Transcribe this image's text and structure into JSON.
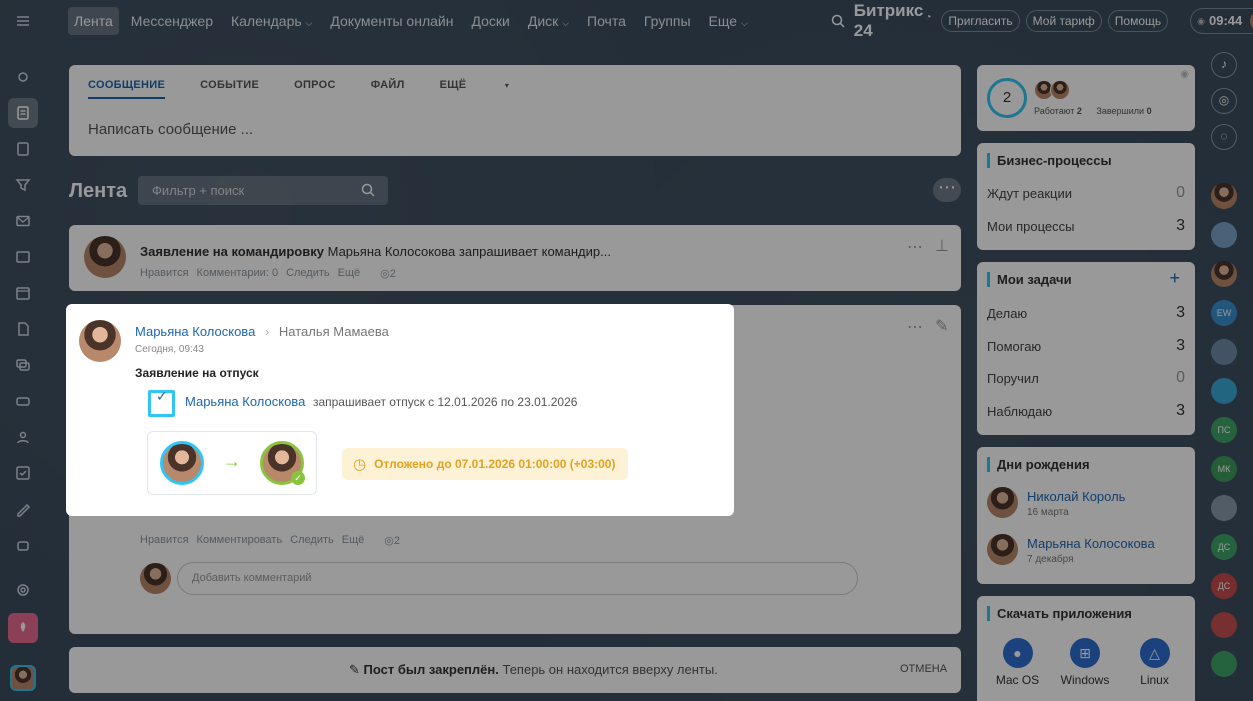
{
  "topbar": {
    "nav": [
      "Лента",
      "Мессенджер",
      "Календарь",
      "Документы онлайн",
      "Доски",
      "Диск",
      "Почта",
      "Группы",
      "Еще"
    ],
    "logo": "Битрикс 24",
    "invite": "Пригласить",
    "tariff": "Мой тариф",
    "help": "Помощь",
    "time": "09:44"
  },
  "composer": {
    "tabs": [
      "СООБЩЕНИЕ",
      "СОБЫТИЕ",
      "ОПРОС",
      "ФАЙЛ",
      "ЕЩЁ"
    ],
    "placeholder": "Написать сообщение ..."
  },
  "feed": {
    "title": "Лента",
    "filter_placeholder": "Фильтр + поиск"
  },
  "post1": {
    "title": "Заявление на командировку",
    "text": "Марьяна Колосокова запрашивает командир...",
    "actions": [
      "Нравится",
      "Комментарии: 0",
      "Следить",
      "Ещё"
    ],
    "views": "2"
  },
  "post2": {
    "actions": [
      "Нравится",
      "Комментировать",
      "Следить",
      "Ещё"
    ],
    "views": "2",
    "comment_placeholder": "Добавить комментарий"
  },
  "pinned": {
    "bold": "Пост был закреплён.",
    "text": "Теперь он находится вверху ленты.",
    "cancel": "ОТМЕНА"
  },
  "popup": {
    "author": "Марьяна Колоскова",
    "recipient": "Наталья Мамаева",
    "time": "Сегодня, 09:43",
    "title": "Заявление на отпуск",
    "requester": "Марьяна Колоскова",
    "request_text": "запрашивает отпуск с 12.01.2026 по 23.01.2026",
    "status": "Отложено до 07.01.2026 01:00:00 (+03:00)"
  },
  "stats": {
    "count": "2",
    "working_label": "Работают",
    "working": "2",
    "done_label": "Завершили",
    "done": "0"
  },
  "bp": {
    "title": "Бизнес-процессы",
    "rows": [
      {
        "label": "Ждут реакции",
        "value": "0"
      },
      {
        "label": "Мои процессы",
        "value": "3"
      }
    ]
  },
  "tasks": {
    "title": "Мои задачи",
    "rows": [
      {
        "label": "Делаю",
        "value": "3"
      },
      {
        "label": "Помогаю",
        "value": "3"
      },
      {
        "label": "Поручил",
        "value": "0"
      },
      {
        "label": "Наблюдаю",
        "value": "3"
      }
    ]
  },
  "birthdays": {
    "title": "Дни рождения",
    "people": [
      {
        "name": "Николай Король",
        "date": "16 марта"
      },
      {
        "name": "Марьяна Колосокова",
        "date": "7 декабря"
      }
    ]
  },
  "apps": {
    "title": "Скачать приложения",
    "items": [
      "Mac OS",
      "Windows",
      "Linux"
    ]
  },
  "right_initials": [
    "EW",
    "ПС",
    "МК",
    "ДС",
    "ДС"
  ]
}
